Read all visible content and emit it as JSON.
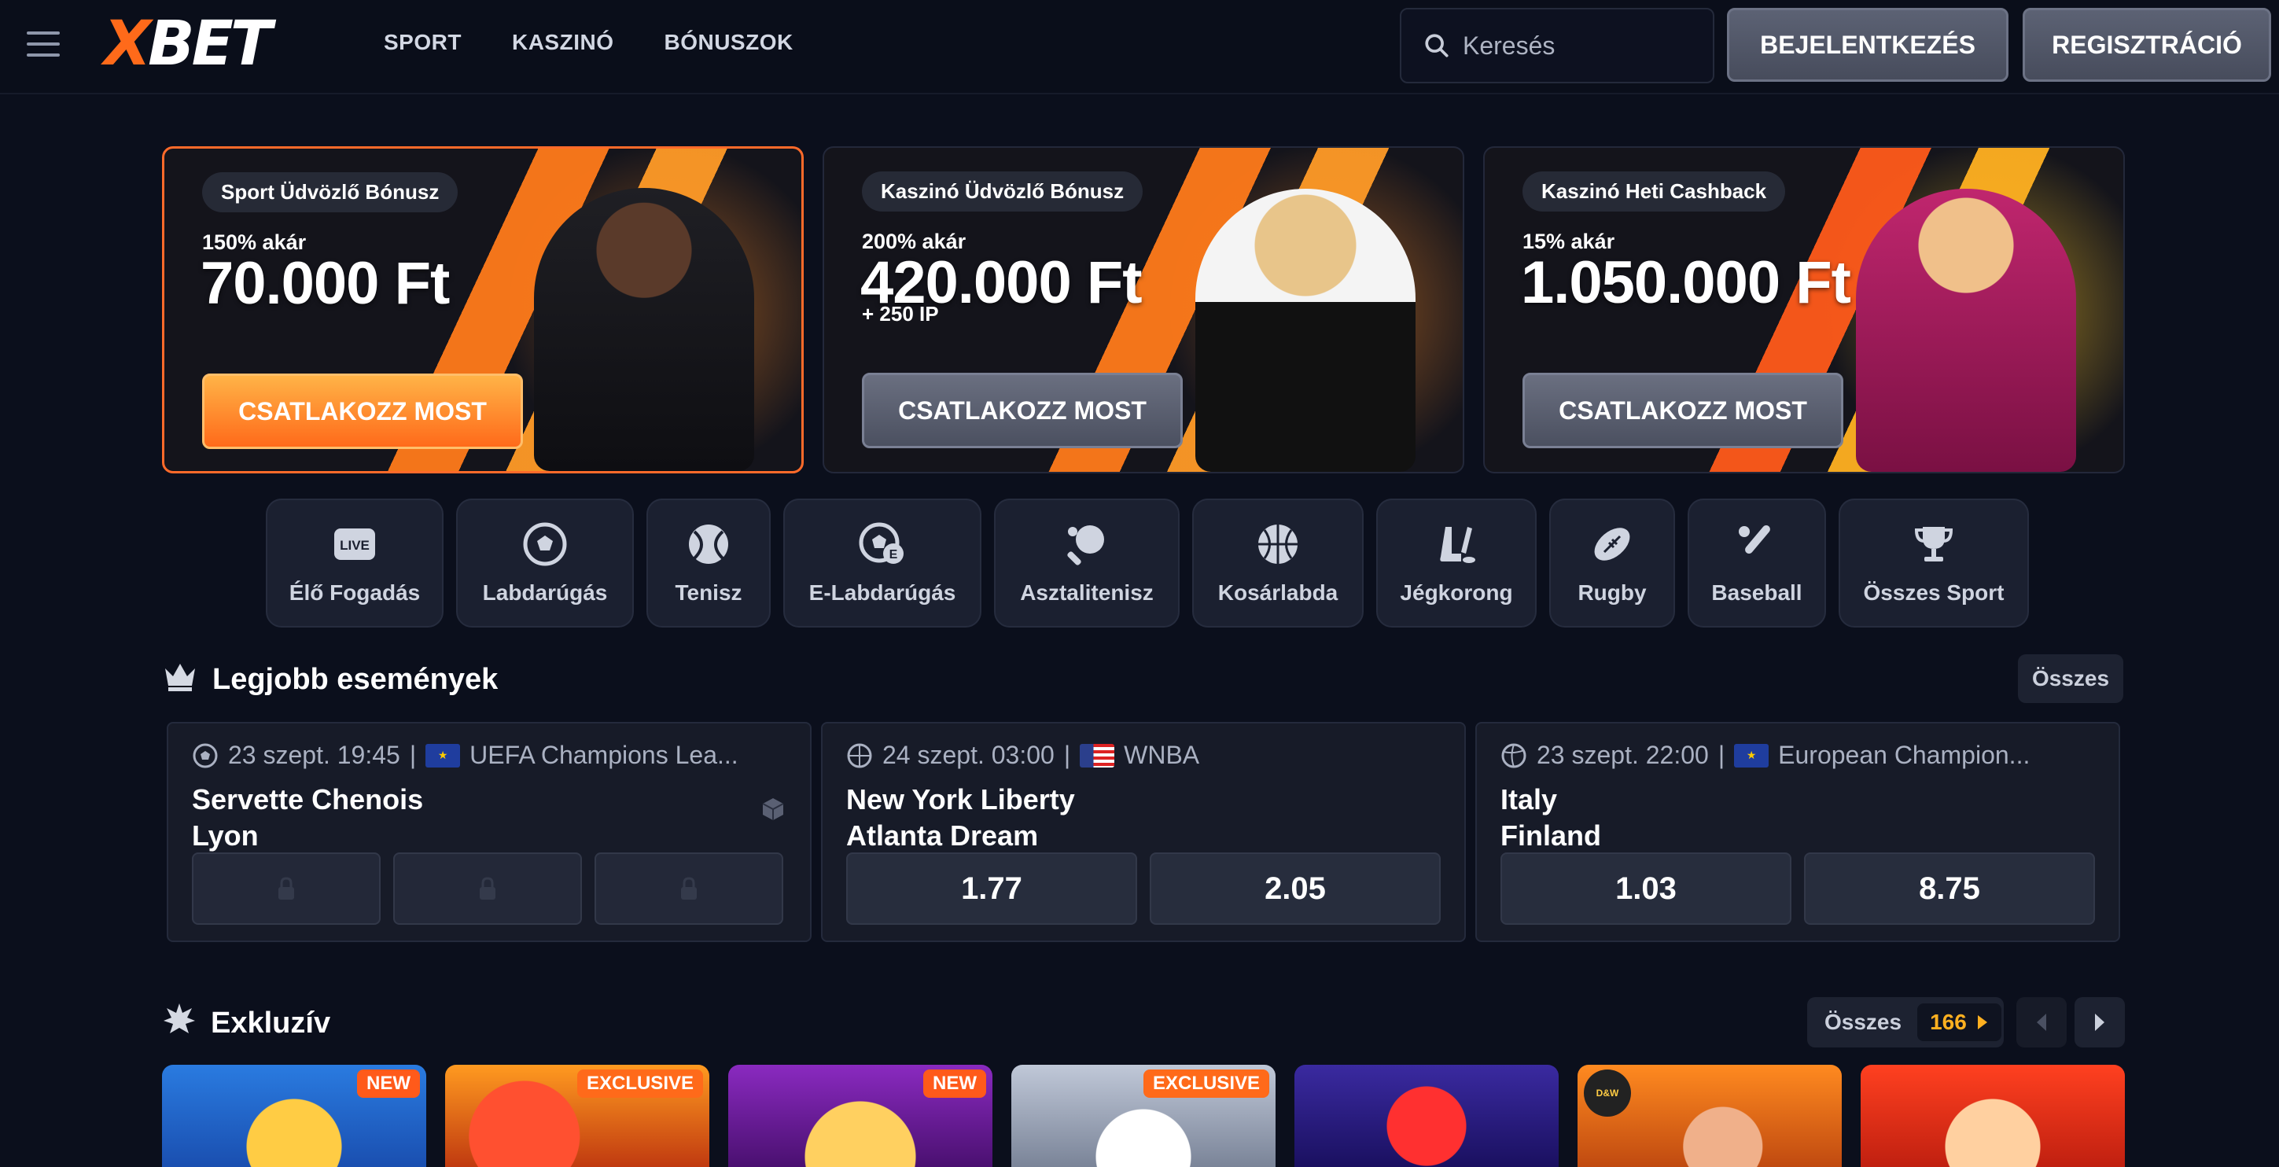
{
  "header": {
    "logo": "XBET",
    "nav": [
      "SPORT",
      "KASZINÓ",
      "BÓNUSZOK"
    ],
    "search_placeholder": "Keresés",
    "login_label": "BEJELENTKEZÉS",
    "register_label": "REGISZTRÁCIÓ"
  },
  "promos": [
    {
      "badge": "Sport Üdvözlő Bónusz",
      "upto": "150% akár",
      "amount": "70.000 Ft",
      "extra": "",
      "cta": "CSATLAKOZZ MOST"
    },
    {
      "badge": "Kaszinó Üdvözlő Bónusz",
      "upto": "200% akár",
      "amount": "420.000 Ft",
      "extra": "+ 250 IP",
      "cta": "CSATLAKOZZ MOST"
    },
    {
      "badge": "Kaszinó Heti Cashback",
      "upto": "15% akár",
      "amount": "1.050.000 Ft",
      "extra": "",
      "cta": "CSATLAKOZZ MOST"
    }
  ],
  "sports": [
    {
      "label": "Élő Fogadás",
      "icon": "live-icon"
    },
    {
      "label": "Labdarúgás",
      "icon": "soccer-ball-icon"
    },
    {
      "label": "Tenisz",
      "icon": "tennis-ball-icon"
    },
    {
      "label": "E-Labdarúgás",
      "icon": "esoccer-icon"
    },
    {
      "label": "Asztalitenisz",
      "icon": "table-tennis-icon"
    },
    {
      "label": "Kosárlabda",
      "icon": "basketball-icon"
    },
    {
      "label": "Jégkorong",
      "icon": "hockey-icon"
    },
    {
      "label": "Rugby",
      "icon": "rugby-ball-icon"
    },
    {
      "label": "Baseball",
      "icon": "baseball-icon"
    },
    {
      "label": "Összes Sport",
      "icon": "trophy-icon"
    }
  ],
  "top_events": {
    "title": "Legjobb események",
    "all_label": "Összes",
    "events": [
      {
        "date": "23 szept. 19:45",
        "league": "UEFA Champions Lea...",
        "team1": "Servette Chenois",
        "team2": "Lyon",
        "odds": []
      },
      {
        "date": "24 szept. 03:00",
        "league": "WNBA",
        "team1": "New York Liberty",
        "team2": "Atlanta Dream",
        "odds": [
          "1.77",
          "2.05"
        ]
      },
      {
        "date": "23 szept. 22:00",
        "league": "European Champion...",
        "team1": "Italy",
        "team2": "Finland",
        "odds": [
          "1.03",
          "8.75"
        ]
      }
    ]
  },
  "exclusive": {
    "title": "Exkluzív",
    "all_label": "Összes",
    "count": "166",
    "games": [
      {
        "tag": "NEW"
      },
      {
        "tag": "EXCLUSIVE"
      },
      {
        "tag": "NEW"
      },
      {
        "tag": "EXCLUSIVE"
      },
      {
        "tag": ""
      },
      {
        "tag": ""
      },
      {
        "tag": ""
      }
    ]
  },
  "colors": {
    "accent": "#ff6a1a",
    "background": "#0b0f1c",
    "odds_count": "#ffb020"
  }
}
